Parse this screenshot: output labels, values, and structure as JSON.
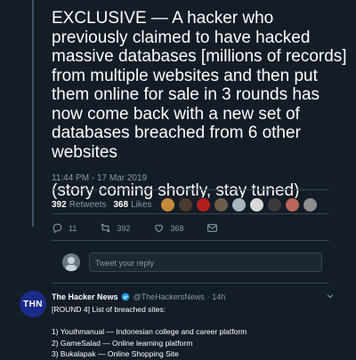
{
  "tweet": {
    "text": "EXCLUSIVE — A hacker who previously claimed to have hacked massive databases [millions of records] from multiple websites and then put them online for sale in 3 rounds has now come back with a new set of databases breached from 6 other websites\n\n(story coming shortly, stay tuned)",
    "timestamp": "11:44 PM - 17 Mar 2019",
    "retweets_count": "392",
    "retweets_label": "Retweets",
    "likes_count": "368",
    "likes_label": "Likes",
    "replies": "11",
    "retweets": "392",
    "likes": "368"
  },
  "reply": {
    "placeholder": "Tweet your reply"
  },
  "next_tweet": {
    "avatar_text": "THN",
    "name": "The Hacker News",
    "handle": "@TheHackersNews",
    "time": "· 14h",
    "body": "[ROUND 4] List of breached sites:\n\n1) Youthmanual — Indonesian college and career platform\n2) GameSalad — Online learning platform\n3) Bukalapak — Online Shopping Site"
  },
  "colors": {
    "background": "#141d26",
    "muted": "#8899a6",
    "divider": "#38444d",
    "accent": "#1da1f2",
    "thn_blue": "#1a2b8a"
  }
}
